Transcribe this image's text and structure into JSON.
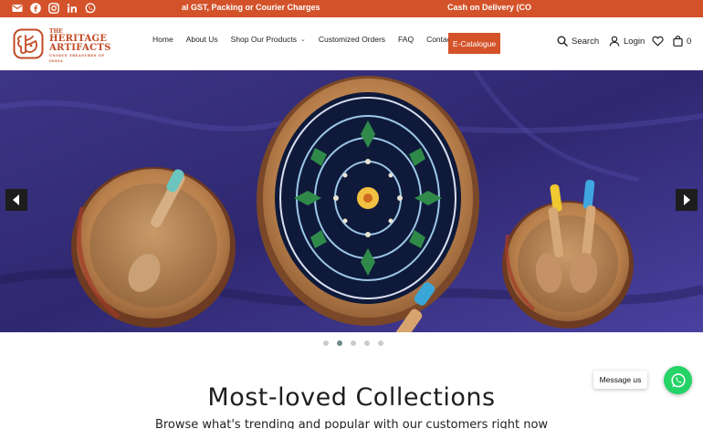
{
  "topbar": {
    "social_icons": [
      "mail-icon",
      "facebook-icon",
      "instagram-icon",
      "linkedin-icon",
      "whatsapp-icon"
    ],
    "ticker": [
      "al GST, Packing or Courier Charges",
      "Cash on Delivery (CO"
    ],
    "background": "#d4522a"
  },
  "brand": {
    "line_the": "THE",
    "line1": "HERITAGE",
    "line2": "ARTIFACTS",
    "tagline": "UNIQUE TREASURES OF INDIA",
    "color": "#c24a26"
  },
  "nav": {
    "items": [
      "Home",
      "About Us",
      "Shop Our Products",
      "Customized Orders",
      "FAQ",
      "Contact Us"
    ],
    "cta": "E-Catalogue",
    "accent": "#d4522a"
  },
  "header_actions": {
    "search_label": "Search",
    "login_label": "Login",
    "cart_count": "0"
  },
  "hero": {
    "slide_count": 5,
    "active_slide": 2
  },
  "section": {
    "title": "Most-loved Collections",
    "subtitle": "Browse what's trending and popular with our customers right now"
  },
  "whatsapp": {
    "bubble_label": "Message us",
    "color": "#25d366"
  }
}
